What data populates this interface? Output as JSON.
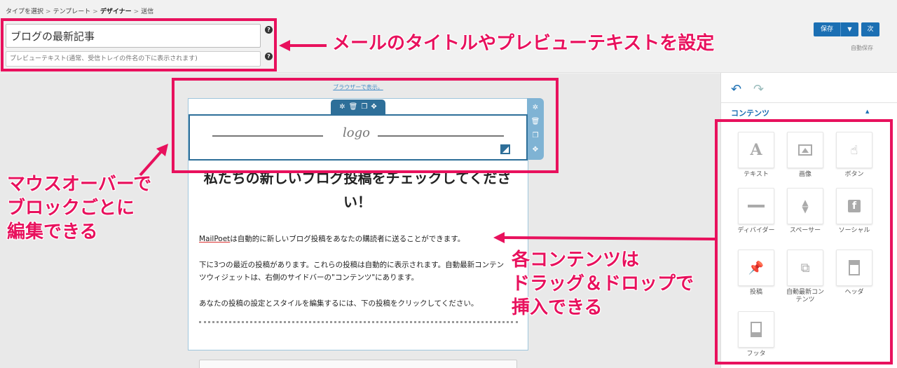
{
  "breadcrumb": {
    "steps": [
      "タイプを選択",
      "テンプレート",
      "デザイナー",
      "送信"
    ],
    "separator": ">"
  },
  "header": {
    "title_value": "ブログの最新記事",
    "preview_placeholder": "プレビューテキスト(通常、受信トレイの件名の下に表示されます)",
    "help_icon": "?",
    "save_label": "保存",
    "save_dropdown_icon": "caret-down-icon",
    "next_label": "次",
    "autosave_label": "自動保存"
  },
  "email": {
    "view_in_browser": "ブラウザーで表示。",
    "logo_text": "logo",
    "heading": "私たちの新しいブログ投稿をチェックしてください！",
    "paragraphs": [
      {
        "lead": "MailPoet",
        "text": "は自動的に新しいブログ投稿をあなたの購読者に送ることができます。"
      },
      {
        "lead": "",
        "text": "下に3つの最近の投稿があります。これらの投稿は自動的に表示されます。自動最新コンテンツウィジェットは、右側のサイドバーの\"コンテンツ\"にあります。"
      },
      {
        "lead": "",
        "text": "あなたの投稿の設定とスタイルを編集するには、下の投稿をクリックしてください。"
      }
    ]
  },
  "block_tools": [
    "gear-icon",
    "trash-icon",
    "duplicate-icon",
    "move-icon"
  ],
  "sidebar": {
    "undo_icon": "undo-icon",
    "redo_icon": "redo-icon",
    "contents_title": "コンテンツ",
    "contents_toggle_icon": "caret-up-icon",
    "widgets": [
      {
        "label": "テキスト",
        "icon": "text-icon"
      },
      {
        "label": "画像",
        "icon": "image-icon"
      },
      {
        "label": "ボタン",
        "icon": "button-icon"
      },
      {
        "label": "ディバイダー",
        "icon": "divider-icon"
      },
      {
        "label": "スペーサー",
        "icon": "spacer-icon"
      },
      {
        "label": "ソーシャル",
        "icon": "facebook-icon"
      },
      {
        "label": "投稿",
        "icon": "post-icon"
      },
      {
        "label": "自動最新コンテンツ",
        "icon": "auto-content-icon"
      },
      {
        "label": "ヘッダ",
        "icon": "header-icon"
      },
      {
        "label": "フッタ",
        "icon": "footer-icon"
      }
    ]
  },
  "annotations": {
    "header_note": "メールのタイトルやプレビューテキストを設定",
    "hover_note": [
      "マウスオーバーで",
      "ブロックごとに",
      "編集できる"
    ],
    "widgets_note": [
      "各コンテンツは",
      "ドラッグ＆ドロップで",
      "挿入できる"
    ],
    "accent_color": "#e8115d"
  },
  "colors": {
    "primary": "#1b6fb3",
    "block_selected": "#2e6f99",
    "block_tools_side": "#7fb3d4"
  }
}
